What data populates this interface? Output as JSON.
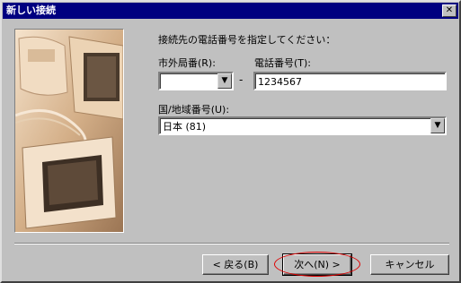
{
  "window": {
    "title": "新しい接続",
    "close_glyph": "✕"
  },
  "form": {
    "instruction": "接続先の電話番号を指定してください：",
    "area_code_label": "市外局番(R):",
    "area_code_value": "",
    "separator_dash": "-",
    "phone_label": "電話番号(T):",
    "phone_value": "1234567",
    "country_label": "国/地域番号(U):",
    "country_value": "日本 (81)"
  },
  "buttons": {
    "back": "< 戻る(B)",
    "next": "次へ(N) >",
    "cancel": "キャンセル"
  },
  "icons": {
    "dropdown": "▼"
  },
  "colors": {
    "titlebar": "#000080",
    "highlight": "#e00000"
  }
}
